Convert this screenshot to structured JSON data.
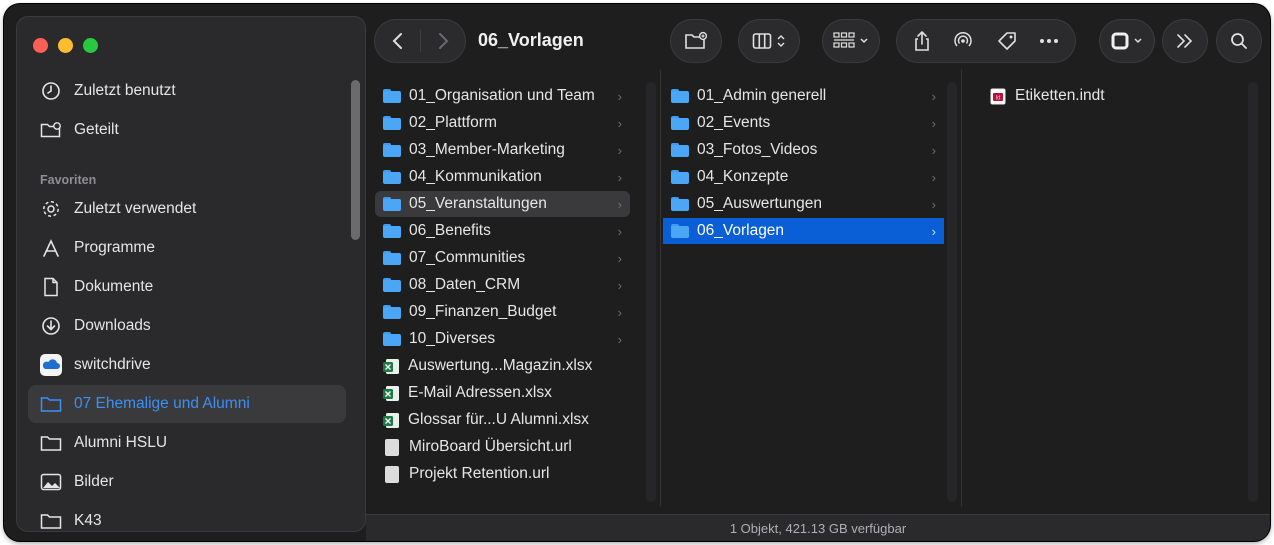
{
  "window": {
    "title": "06_Vorlagen"
  },
  "sidebar": {
    "top_items": [
      {
        "label": "Zuletzt benutzt",
        "icon": "clock-icon"
      },
      {
        "label": "Geteilt",
        "icon": "shared-folder-icon"
      }
    ],
    "section_label": "Favoriten",
    "items": [
      {
        "label": "Zuletzt verwendet",
        "icon": "gear-icon"
      },
      {
        "label": "Programme",
        "icon": "apps-icon"
      },
      {
        "label": "Dokumente",
        "icon": "document-icon"
      },
      {
        "label": "Downloads",
        "icon": "download-icon"
      },
      {
        "label": "switchdrive",
        "icon": "cloud-icon"
      },
      {
        "label": "07 Ehemalige und Alumni",
        "icon": "folder-icon",
        "selected": true
      },
      {
        "label": "Alumni HSLU",
        "icon": "folder-icon"
      },
      {
        "label": "Bilder",
        "icon": "photo-icon"
      },
      {
        "label": "K43",
        "icon": "folder-icon"
      }
    ]
  },
  "columns": {
    "col1": [
      {
        "label": "01_Organisation und Team",
        "type": "folder"
      },
      {
        "label": "02_Plattform",
        "type": "folder"
      },
      {
        "label": "03_Member-Marketing",
        "type": "folder"
      },
      {
        "label": "04_Kommunikation",
        "type": "folder"
      },
      {
        "label": "05_Veranstaltungen",
        "type": "folder",
        "state": "highlight"
      },
      {
        "label": "06_Benefits",
        "type": "folder"
      },
      {
        "label": "07_Communities",
        "type": "folder"
      },
      {
        "label": "08_Daten_CRM",
        "type": "folder"
      },
      {
        "label": "09_Finanzen_Budget",
        "type": "folder"
      },
      {
        "label": "10_Diverses",
        "type": "folder"
      },
      {
        "label": "Auswertung...Magazin.xlsx",
        "type": "xlsx"
      },
      {
        "label": "E-Mail Adressen.xlsx",
        "type": "xlsx"
      },
      {
        "label": "Glossar für...U Alumni.xlsx",
        "type": "xlsx"
      },
      {
        "label": "MiroBoard Übersicht.url",
        "type": "url"
      },
      {
        "label": "Projekt Retention.url",
        "type": "url"
      }
    ],
    "col2": [
      {
        "label": "01_Admin generell",
        "type": "folder"
      },
      {
        "label": "02_Events",
        "type": "folder"
      },
      {
        "label": "03_Fotos_Videos",
        "type": "folder"
      },
      {
        "label": "04_Konzepte",
        "type": "folder"
      },
      {
        "label": "05_Auswertungen",
        "type": "folder"
      },
      {
        "label": "06_Vorlagen",
        "type": "folder",
        "state": "active"
      }
    ],
    "col3": [
      {
        "label": "Etiketten.indt",
        "type": "indt"
      }
    ]
  },
  "status": {
    "text": "1 Objekt, 421.13 GB verfügbar"
  },
  "colors": {
    "accent": "#0a5fd6",
    "sidebar_selected_text": "#3b8ff5",
    "folder": "#4ba6f5"
  }
}
